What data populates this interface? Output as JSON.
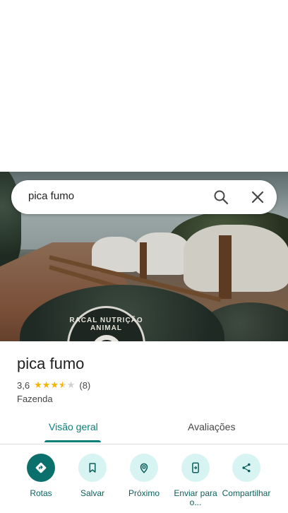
{
  "search": {
    "query": "pica fumo"
  },
  "hero": {
    "badge_text": "RACAL NUTRIÇÃO ANIMAL"
  },
  "place": {
    "name": "pica fumo",
    "rating": "3,6",
    "rating_stars": 3.6,
    "review_count": "(8)",
    "category": "Fazenda"
  },
  "tabs": [
    {
      "label": "Visão geral",
      "active": true
    },
    {
      "label": "Avaliações",
      "active": false
    }
  ],
  "actions": [
    {
      "label": "Rotas",
      "icon": "directions-icon"
    },
    {
      "label": "Salvar",
      "icon": "bookmark-icon"
    },
    {
      "label": "Próximo",
      "icon": "nearby-icon"
    },
    {
      "label": "Enviar para o...",
      "icon": "send-to-phone-icon"
    },
    {
      "label": "Compartilhar",
      "icon": "share-icon"
    }
  ],
  "colors": {
    "accent": "#0b7f7a",
    "action_bg": "#d7f3f2",
    "star": "#f5b400"
  }
}
